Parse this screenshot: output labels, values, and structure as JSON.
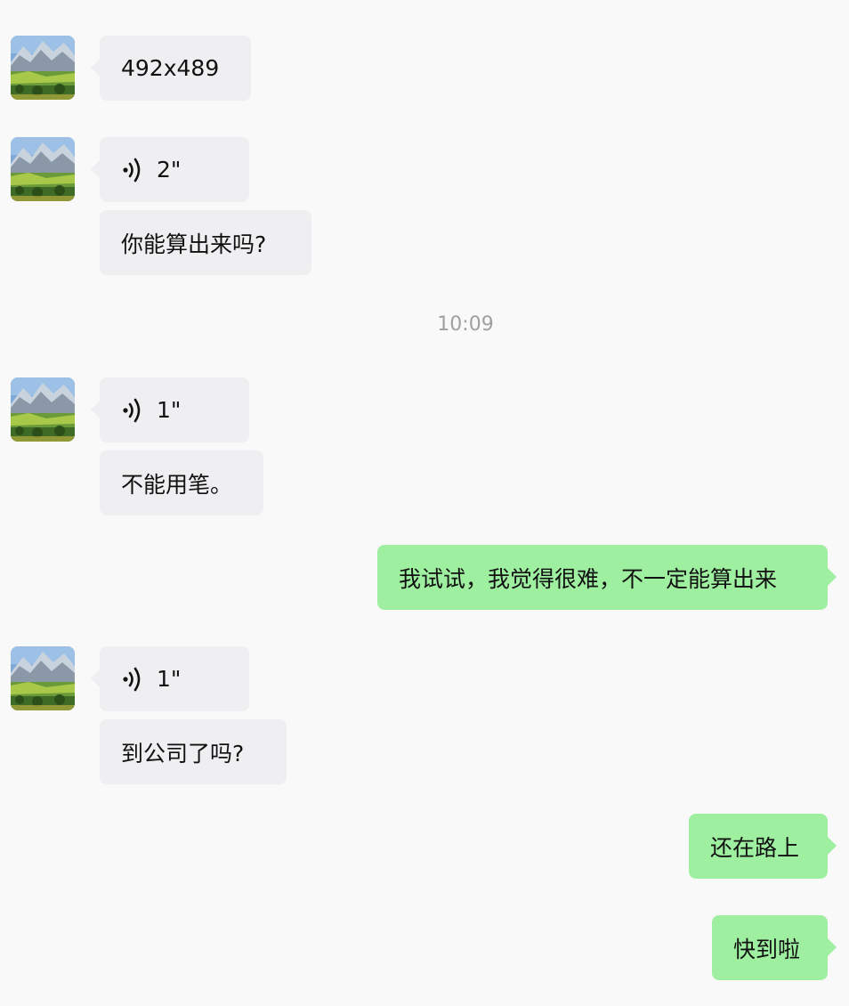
{
  "chat": {
    "messages": [
      {
        "text": "492x489"
      },
      {
        "voice_duration": "2\""
      },
      {
        "text": "你能算出来吗?"
      },
      {
        "voice_duration": "1\""
      },
      {
        "text": "不能用笔。"
      },
      {
        "text": "我试试，我觉得很难，不一定能算出来"
      },
      {
        "voice_duration": "1\""
      },
      {
        "text": "到公司了吗?"
      },
      {
        "text": "还在路上"
      },
      {
        "text": "快到啦"
      }
    ],
    "timestamp": "10:09"
  },
  "colors": {
    "background": "#f9f9f9",
    "incoming_bubble": "#efeff1",
    "outgoing_bubble": "#9ef0a0",
    "timestamp_text": "#a0a0a0"
  },
  "icons": {
    "avatar": "landscape-avatar-image",
    "voice": "voice-wave-icon"
  }
}
